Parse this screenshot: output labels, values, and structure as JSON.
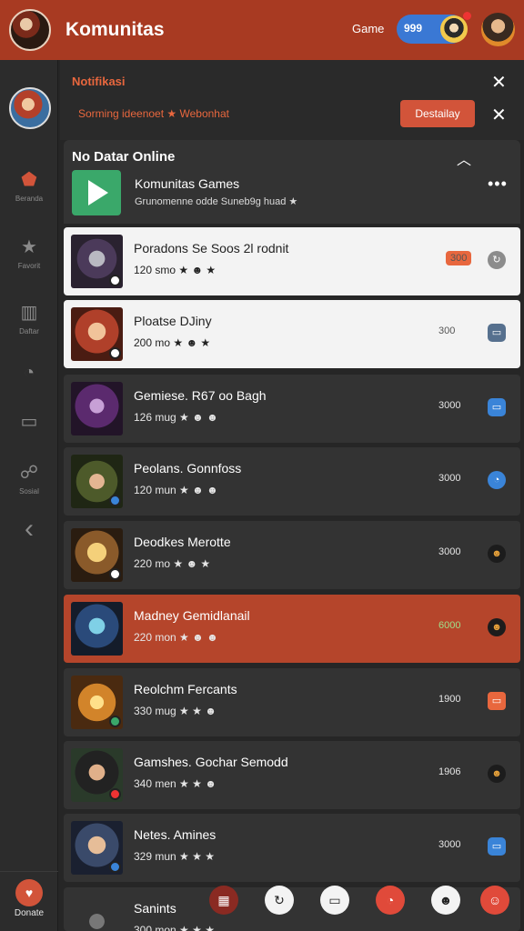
{
  "header": {
    "title": "Komunitas",
    "game_label": "Game",
    "toggle_value": "999"
  },
  "sidebar": {
    "items": [
      {
        "label": "Beranda",
        "icon": "home-icon",
        "glyph": "⬟"
      },
      {
        "label": "Favorit",
        "icon": "star-icon",
        "glyph": "★"
      },
      {
        "label": "Daftar",
        "icon": "list-icon",
        "glyph": "▥"
      },
      {
        "label": "",
        "icon": "chat-icon",
        "glyph": "◔"
      },
      {
        "label": "",
        "icon": "message-icon",
        "glyph": "▭"
      },
      {
        "label": "Sosial",
        "icon": "people-icon",
        "glyph": "☍"
      },
      {
        "label": "",
        "icon": "back-icon",
        "glyph": "‹"
      }
    ],
    "bottom_label": "Donate"
  },
  "notification": {
    "title": "Notifikasi",
    "text": "Sorming ideenoet ★ Webonhat",
    "button_label": "Destailay"
  },
  "online_panel": {
    "title": "No Datar Online",
    "game_name": "Komunitas Games",
    "description": "Grunomenne odde Suneb9g huad ★"
  },
  "rows": [
    {
      "name": "Poradons Se Soos 2l rodnit",
      "meta": "120 smo ★ ☻ ★",
      "count": "300",
      "variant": "light",
      "count_style": "pill"
    },
    {
      "name": "Ploatse DJiny",
      "meta": "200 mo ★ ☻ ★",
      "count": "300",
      "variant": "light",
      "count_style": "plain"
    },
    {
      "name": "Gemiese. R67 oo Bagh",
      "meta": "126 mug ★ ☻ ☻",
      "count": "3000",
      "variant": "dark",
      "count_style": "plain"
    },
    {
      "name": "Peolans. Gonnfoss",
      "meta": "120 mun ★ ☻ ☻",
      "count": "3000",
      "variant": "dark",
      "count_style": "plain"
    },
    {
      "name": "Deodkes Merotte",
      "meta": "220 mo ★ ☻ ★",
      "count": "3000",
      "variant": "dark",
      "count_style": "plain"
    },
    {
      "name": "Madney Gemidlanail",
      "meta": "220 mon ★ ☻ ☻",
      "count": "6000",
      "variant": "highlight",
      "count_style": "plain"
    },
    {
      "name": "Reolchm Fercants",
      "meta": "330 mug ★ ★ ☻",
      "count": "1900",
      "variant": "dark",
      "count_style": "plain"
    },
    {
      "name": "Gamshes. Gochar Semodd",
      "meta": "340 men ★ ★ ☻",
      "count": "1906",
      "variant": "dark",
      "count_style": "plain"
    },
    {
      "name": "Netes. Amines",
      "meta": "329 mun ★ ★ ★",
      "count": "3000",
      "variant": "dark",
      "count_style": "plain"
    },
    {
      "name": "Sanints",
      "meta": "300 mon ★ ★ ★",
      "count": "",
      "variant": "dark",
      "count_style": "plain"
    }
  ],
  "colors": {
    "header_bg": "#a83a22",
    "accent": "#e8673e",
    "row_dark": "#333333",
    "row_light": "#f3f3f3",
    "row_highlight": "#b5452b"
  }
}
